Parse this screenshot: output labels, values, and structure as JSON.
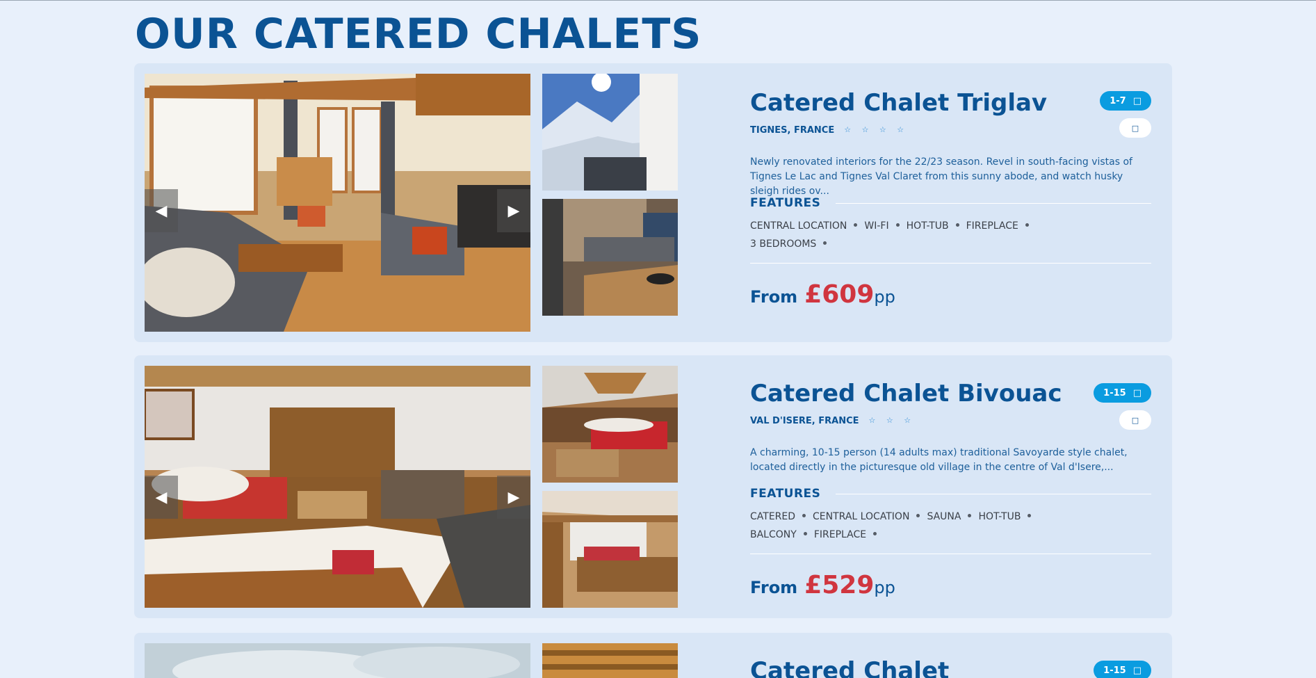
{
  "page_title": "OUR CATERED CHALETS",
  "icons": {
    "user": "user-icon",
    "heart": "heart-icon",
    "star": "star-icon",
    "prev": "chevron-left-icon",
    "next": "chevron-right-icon"
  },
  "colors": {
    "title": "#0b5394",
    "price": "#d0353f",
    "badge": "#0a9ce0",
    "card": "#d9e6f6",
    "background": "#e8f0fb"
  },
  "chalets": [
    {
      "name": "Catered Chalet Triglav",
      "location": "TIGNES, FRANCE",
      "stars": "☆ ☆ ☆ ☆",
      "capacity": "1-7",
      "description": "Newly renovated interiors for the 22/23 season. Revel in south-facing vistas of Tignes Le Lac and Tignes Val Claret from this sunny abode, and watch husky sleigh rides ov...",
      "features_label": "FEATURES",
      "features_line1": [
        "CENTRAL LOCATION",
        "WI-FI",
        "HOT-TUB",
        "FIREPLACE"
      ],
      "features_line2": [
        "3 BEDROOMS"
      ],
      "price_from": "From",
      "price": "£609",
      "price_unit": "pp"
    },
    {
      "name": "Catered Chalet Bivouac",
      "location": "VAL D'ISERE, FRANCE",
      "stars": "☆ ☆ ☆",
      "capacity": "1-15",
      "description": "A charming, 10-15 person (14 adults max) traditional Savoyarde style chalet, located directly in the picturesque old village in the centre of Val d'Isere,...",
      "features_label": "FEATURES",
      "features_line1": [
        "CATERED",
        "CENTRAL LOCATION",
        "SAUNA",
        "HOT-TUB"
      ],
      "features_line2": [
        "BALCONY",
        "FIREPLACE"
      ],
      "price_from": "From",
      "price": "£529",
      "price_unit": "pp"
    },
    {
      "name": "Catered Chalet",
      "capacity": "1-15"
    }
  ]
}
